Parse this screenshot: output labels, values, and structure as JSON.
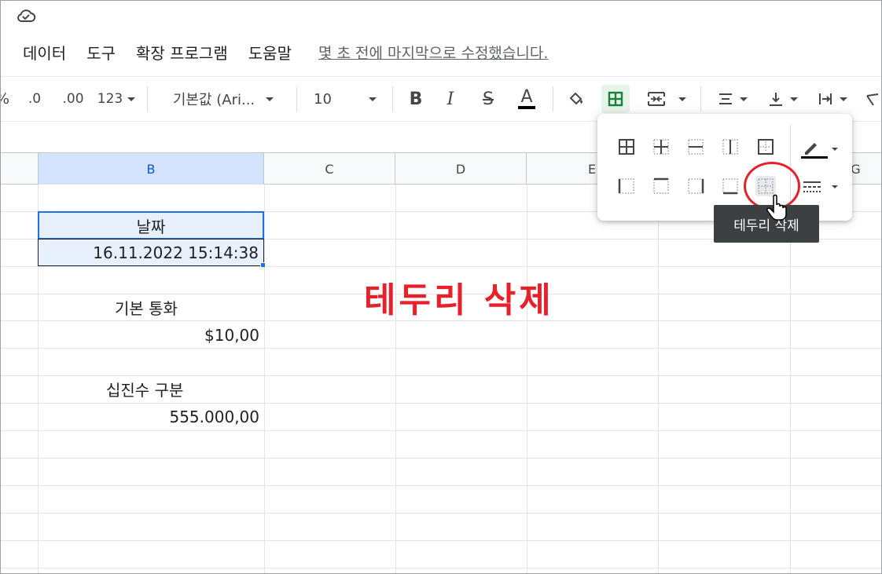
{
  "menu": {
    "items": [
      "데이터",
      "도구",
      "확장 프로그램",
      "도움말"
    ],
    "last_edit": "몇 초 전에 마지막으로 수정했습니다."
  },
  "toolbar": {
    "percent": "%",
    "decimal_decrease": ".0",
    "decimal_increase": ".00",
    "number_format": "123",
    "font_family": "기본값 (Ari...",
    "font_size": "10",
    "bold": "B",
    "italic": "I",
    "strikethrough": "S",
    "text_color": "A"
  },
  "columns": [
    "B",
    "C",
    "D",
    "E",
    "G"
  ],
  "cells": {
    "date_label": "날짜",
    "date_value": "16.11.2022 15:14:38",
    "currency_label": "기본 통화",
    "currency_value": "$10,00",
    "decimal_label": "십진수 구분",
    "decimal_value": "555.000,00"
  },
  "annotation": "테두리 삭제",
  "borders_menu": {
    "tooltip": "테두리 삭제",
    "icons": [
      "all-borders",
      "inner-borders",
      "horizontal-borders",
      "vertical-borders",
      "outer-borders",
      "left-border",
      "top-border",
      "right-border",
      "bottom-border",
      "clear-borders"
    ]
  },
  "colors": {
    "accent": "#1a73e8",
    "annotation": "#e8202a",
    "selected_fill": "#e8f0fe"
  }
}
